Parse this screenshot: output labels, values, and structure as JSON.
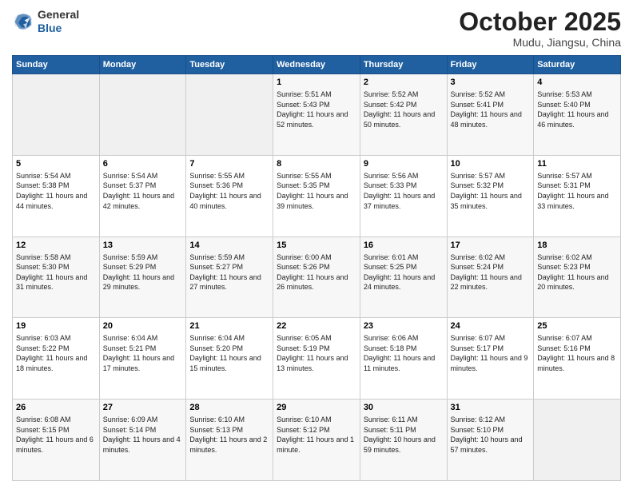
{
  "header": {
    "logo_general": "General",
    "logo_blue": "Blue",
    "month_title": "October 2025",
    "location": "Mudu, Jiangsu, China"
  },
  "weekdays": [
    "Sunday",
    "Monday",
    "Tuesday",
    "Wednesday",
    "Thursday",
    "Friday",
    "Saturday"
  ],
  "weeks": [
    [
      {
        "day": "",
        "empty": true
      },
      {
        "day": "",
        "empty": true
      },
      {
        "day": "",
        "empty": true
      },
      {
        "day": "1",
        "sunrise": "5:51 AM",
        "sunset": "5:43 PM",
        "daylight": "11 hours and 52 minutes."
      },
      {
        "day": "2",
        "sunrise": "5:52 AM",
        "sunset": "5:42 PM",
        "daylight": "11 hours and 50 minutes."
      },
      {
        "day": "3",
        "sunrise": "5:52 AM",
        "sunset": "5:41 PM",
        "daylight": "11 hours and 48 minutes."
      },
      {
        "day": "4",
        "sunrise": "5:53 AM",
        "sunset": "5:40 PM",
        "daylight": "11 hours and 46 minutes."
      }
    ],
    [
      {
        "day": "5",
        "sunrise": "5:54 AM",
        "sunset": "5:38 PM",
        "daylight": "11 hours and 44 minutes."
      },
      {
        "day": "6",
        "sunrise": "5:54 AM",
        "sunset": "5:37 PM",
        "daylight": "11 hours and 42 minutes."
      },
      {
        "day": "7",
        "sunrise": "5:55 AM",
        "sunset": "5:36 PM",
        "daylight": "11 hours and 40 minutes."
      },
      {
        "day": "8",
        "sunrise": "5:55 AM",
        "sunset": "5:35 PM",
        "daylight": "11 hours and 39 minutes."
      },
      {
        "day": "9",
        "sunrise": "5:56 AM",
        "sunset": "5:33 PM",
        "daylight": "11 hours and 37 minutes."
      },
      {
        "day": "10",
        "sunrise": "5:57 AM",
        "sunset": "5:32 PM",
        "daylight": "11 hours and 35 minutes."
      },
      {
        "day": "11",
        "sunrise": "5:57 AM",
        "sunset": "5:31 PM",
        "daylight": "11 hours and 33 minutes."
      }
    ],
    [
      {
        "day": "12",
        "sunrise": "5:58 AM",
        "sunset": "5:30 PM",
        "daylight": "11 hours and 31 minutes."
      },
      {
        "day": "13",
        "sunrise": "5:59 AM",
        "sunset": "5:29 PM",
        "daylight": "11 hours and 29 minutes."
      },
      {
        "day": "14",
        "sunrise": "5:59 AM",
        "sunset": "5:27 PM",
        "daylight": "11 hours and 27 minutes."
      },
      {
        "day": "15",
        "sunrise": "6:00 AM",
        "sunset": "5:26 PM",
        "daylight": "11 hours and 26 minutes."
      },
      {
        "day": "16",
        "sunrise": "6:01 AM",
        "sunset": "5:25 PM",
        "daylight": "11 hours and 24 minutes."
      },
      {
        "day": "17",
        "sunrise": "6:02 AM",
        "sunset": "5:24 PM",
        "daylight": "11 hours and 22 minutes."
      },
      {
        "day": "18",
        "sunrise": "6:02 AM",
        "sunset": "5:23 PM",
        "daylight": "11 hours and 20 minutes."
      }
    ],
    [
      {
        "day": "19",
        "sunrise": "6:03 AM",
        "sunset": "5:22 PM",
        "daylight": "11 hours and 18 minutes."
      },
      {
        "day": "20",
        "sunrise": "6:04 AM",
        "sunset": "5:21 PM",
        "daylight": "11 hours and 17 minutes."
      },
      {
        "day": "21",
        "sunrise": "6:04 AM",
        "sunset": "5:20 PM",
        "daylight": "11 hours and 15 minutes."
      },
      {
        "day": "22",
        "sunrise": "6:05 AM",
        "sunset": "5:19 PM",
        "daylight": "11 hours and 13 minutes."
      },
      {
        "day": "23",
        "sunrise": "6:06 AM",
        "sunset": "5:18 PM",
        "daylight": "11 hours and 11 minutes."
      },
      {
        "day": "24",
        "sunrise": "6:07 AM",
        "sunset": "5:17 PM",
        "daylight": "11 hours and 9 minutes."
      },
      {
        "day": "25",
        "sunrise": "6:07 AM",
        "sunset": "5:16 PM",
        "daylight": "11 hours and 8 minutes."
      }
    ],
    [
      {
        "day": "26",
        "sunrise": "6:08 AM",
        "sunset": "5:15 PM",
        "daylight": "11 hours and 6 minutes."
      },
      {
        "day": "27",
        "sunrise": "6:09 AM",
        "sunset": "5:14 PM",
        "daylight": "11 hours and 4 minutes."
      },
      {
        "day": "28",
        "sunrise": "6:10 AM",
        "sunset": "5:13 PM",
        "daylight": "11 hours and 2 minutes."
      },
      {
        "day": "29",
        "sunrise": "6:10 AM",
        "sunset": "5:12 PM",
        "daylight": "11 hours and 1 minute."
      },
      {
        "day": "30",
        "sunrise": "6:11 AM",
        "sunset": "5:11 PM",
        "daylight": "10 hours and 59 minutes."
      },
      {
        "day": "31",
        "sunrise": "6:12 AM",
        "sunset": "5:10 PM",
        "daylight": "10 hours and 57 minutes."
      },
      {
        "day": "",
        "empty": true
      }
    ]
  ],
  "labels": {
    "sunrise": "Sunrise:",
    "sunset": "Sunset:",
    "daylight": "Daylight:"
  }
}
